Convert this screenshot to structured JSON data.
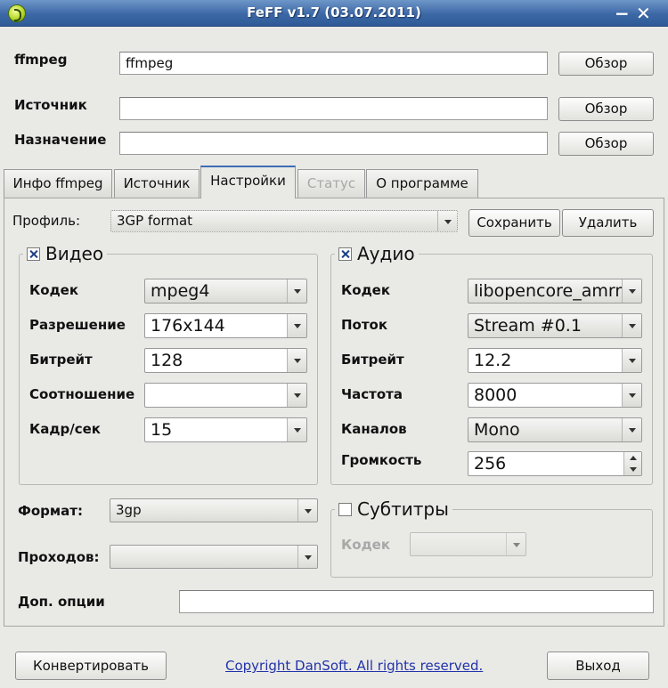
{
  "window": {
    "title": "FeFF  v1.7 (03.07.2011)"
  },
  "top": {
    "ffmpeg_label": "ffmpeg",
    "ffmpeg_value": "ffmpeg",
    "source_label": "Источник",
    "source_value": "",
    "dest_label": "Назначение",
    "dest_value": "",
    "browse_label": "Обзор"
  },
  "tabs": [
    {
      "label": "Инфо ffmpeg"
    },
    {
      "label": "Источник"
    },
    {
      "label": "Настройки",
      "active": true
    },
    {
      "label": "Статус",
      "disabled": true
    },
    {
      "label": "О программе"
    }
  ],
  "settings": {
    "profile_label": "Профиль:",
    "profile_value": "3GP format",
    "save_label": "Сохранить",
    "delete_label": "Удалить",
    "video": {
      "title": "Видео",
      "enabled": true,
      "codec_label": "Кодек",
      "codec_value": "mpeg4",
      "resolution_label": "Разрешение",
      "resolution_value": "176x144",
      "bitrate_label": "Битрейт",
      "bitrate_value": "128",
      "aspect_label": "Соотношение",
      "aspect_value": "",
      "fps_label": "Кадр/сек",
      "fps_value": "15"
    },
    "audio": {
      "title": "Аудио",
      "enabled": true,
      "codec_label": "Кодек",
      "codec_value": "libopencore_amrnb",
      "stream_label": "Поток",
      "stream_value": "Stream #0.1",
      "bitrate_label": "Битрейт",
      "bitrate_value": "12.2",
      "rate_label": "Частота",
      "rate_value": "8000",
      "channels_label": "Каналов",
      "channels_value": "Mono",
      "volume_label": "Громкость",
      "volume_value": "256"
    },
    "format_label": "Формат:",
    "format_value": "3gp",
    "passes_label": "Проходов:",
    "passes_value": "",
    "subtitles": {
      "title": "Субтитры",
      "enabled": false,
      "codec_label": "Кодек",
      "codec_value": ""
    },
    "extra_label": "Доп. опции",
    "extra_value": ""
  },
  "footer": {
    "convert_label": "Конвертировать",
    "copyright": "Copyright DanSoft. All rights reserved.",
    "exit_label": "Выход"
  }
}
